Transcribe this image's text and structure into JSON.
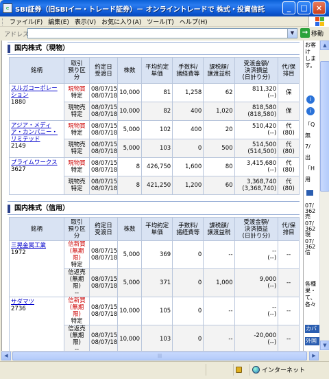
{
  "window": {
    "title": "SBI証券（旧SBIイー・トレード証券）－ オンライントレードで 株式・投資信託・債券を － Micr...",
    "icon": "ie-page-icon"
  },
  "menu": [
    "ファイル(F)",
    "編集(E)",
    "表示(V)",
    "お気に入り(A)",
    "ツール(T)",
    "ヘルプ(H)"
  ],
  "address": {
    "label": "アドレス(D)",
    "value": "",
    "go_label": "移動"
  },
  "genbutsu": {
    "title": "国内株式（現物）",
    "headers": [
      "銘柄",
      "取引\n預り区分",
      "約定日\n受渡日",
      "株数",
      "平均約定\n単価",
      "手数料/\n諸経費等",
      "課税額/\n譲渡益税",
      "受渡金額/\n決済損益\n(日計り分)",
      "代/保\n排目"
    ],
    "rows": [
      {
        "name": "スルガコーポレーション",
        "code": "1880",
        "sub": [
          {
            "kubun": "現物買",
            "azukari": "特定",
            "yaku": "08/07/15",
            "uke": "08/07/18",
            "qty": "10,000",
            "price": "81",
            "fee": "1,258",
            "tax": "62",
            "amt": "811,320",
            "amt2": "(--)",
            "flag": "保"
          },
          {
            "kubun": "現物売",
            "azukari": "特定",
            "yaku": "08/07/15",
            "uke": "08/07/18",
            "qty": "10,000",
            "price": "82",
            "fee": "400",
            "tax": "1,020",
            "amt": "818,580",
            "amt2": "(818,580)",
            "flag": "保"
          }
        ]
      },
      {
        "name": "アジア・メディア・カンパニー・リミテッド",
        "code": "2149",
        "sub": [
          {
            "kubun": "現物買",
            "azukari": "特定",
            "yaku": "08/07/15",
            "uke": "08/07/18",
            "qty": "5,000",
            "price": "102",
            "fee": "400",
            "tax": "20",
            "amt": "510,420",
            "amt2": "(--)",
            "flag": "代\n(80)"
          },
          {
            "kubun": "現物売",
            "azukari": "特定",
            "yaku": "08/07/15",
            "uke": "08/07/18",
            "qty": "5,000",
            "price": "103",
            "fee": "0",
            "tax": "500",
            "amt": "514,500",
            "amt2": "(514,500)",
            "flag": "代\n(80)"
          }
        ]
      },
      {
        "name": "プライムワークス",
        "code": "3627",
        "sub": [
          {
            "kubun": "現物買",
            "azukari": "特定",
            "yaku": "08/07/15",
            "uke": "08/07/18",
            "qty": "8",
            "price": "426,750",
            "fee": "1,600",
            "tax": "80",
            "amt": "3,415,680",
            "amt2": "(--)",
            "flag": "代\n(80)"
          },
          {
            "kubun": "現物売",
            "azukari": "特定",
            "yaku": "08/07/15",
            "uke": "08/07/18",
            "qty": "8",
            "price": "421,250",
            "fee": "1,200",
            "tax": "60",
            "amt": "3,368,740",
            "amt2": "(3,368,740)",
            "flag": "代\n(80)"
          }
        ]
      }
    ]
  },
  "shinyo": {
    "title": "国内株式（信用）",
    "headers": [
      "銘柄",
      "取引\n預り区\n分",
      "約定日\n受渡日",
      "株数",
      "平均約定\n単価",
      "手数料/\n諸経費等",
      "課税額/\n譲渡益税",
      "受渡金額/\n決済損益\n(日計り分)",
      "代/保\n排目"
    ],
    "rows": [
      {
        "name": "三晃金属工業",
        "code": "1972",
        "sub": [
          {
            "kubun": "信新買\n(無期限)",
            "azukari": "特定",
            "yaku": "08/07/15",
            "uke": "08/07/18",
            "qty": "5,000",
            "price": "369",
            "fee": "0",
            "tax": "--",
            "amt": "--",
            "amt2": "(--)",
            "flag": "--"
          },
          {
            "kubun": "信返売\n(無期限)",
            "azukari": "--",
            "yaku": "08/07/15",
            "uke": "08/07/18",
            "qty": "5,000",
            "price": "371",
            "fee": "0",
            "tax": "1,000",
            "amt": "9,000",
            "amt2": "(--)",
            "flag": "--"
          }
        ]
      },
      {
        "name": "サダマツ",
        "code": "2736",
        "sub": [
          {
            "kubun": "信新買\n(無期限)",
            "azukari": "特定",
            "yaku": "08/07/15",
            "uke": "08/07/18",
            "qty": "10,000",
            "price": "105",
            "fee": "0",
            "tax": "--",
            "amt": "--",
            "amt2": "(--)",
            "flag": "--"
          },
          {
            "kubun": "信返売\n(無期限)",
            "azukari": "--",
            "yaku": "08/07/15",
            "uke": "08/07/18",
            "qty": "10,000",
            "price": "103",
            "fee": "0",
            "tax": "--",
            "amt": "-20,000",
            "amt2": "(--)",
            "flag": "--"
          }
        ]
      }
    ]
  },
  "sidepane_texts": [
    "お客",
    "け",
    "しま",
    "す。",
    "「Q",
    "無",
    "7/",
    "出",
    "「H",
    "用",
    "07/",
    "362",
    "売",
    "07/",
    "362",
    "現",
    "07/",
    "362",
    "信",
    "各種",
    "果・",
    "て、",
    "各々"
  ],
  "sidepane_buttons": [
    "カバ",
    "外国"
  ],
  "status": {
    "zone": "インターネット"
  },
  "colors": {
    "titlebar": "#0a5fd6",
    "header_bg": "#d9e3f3",
    "buy_red": "#cc0000",
    "link": "#0000cc"
  }
}
